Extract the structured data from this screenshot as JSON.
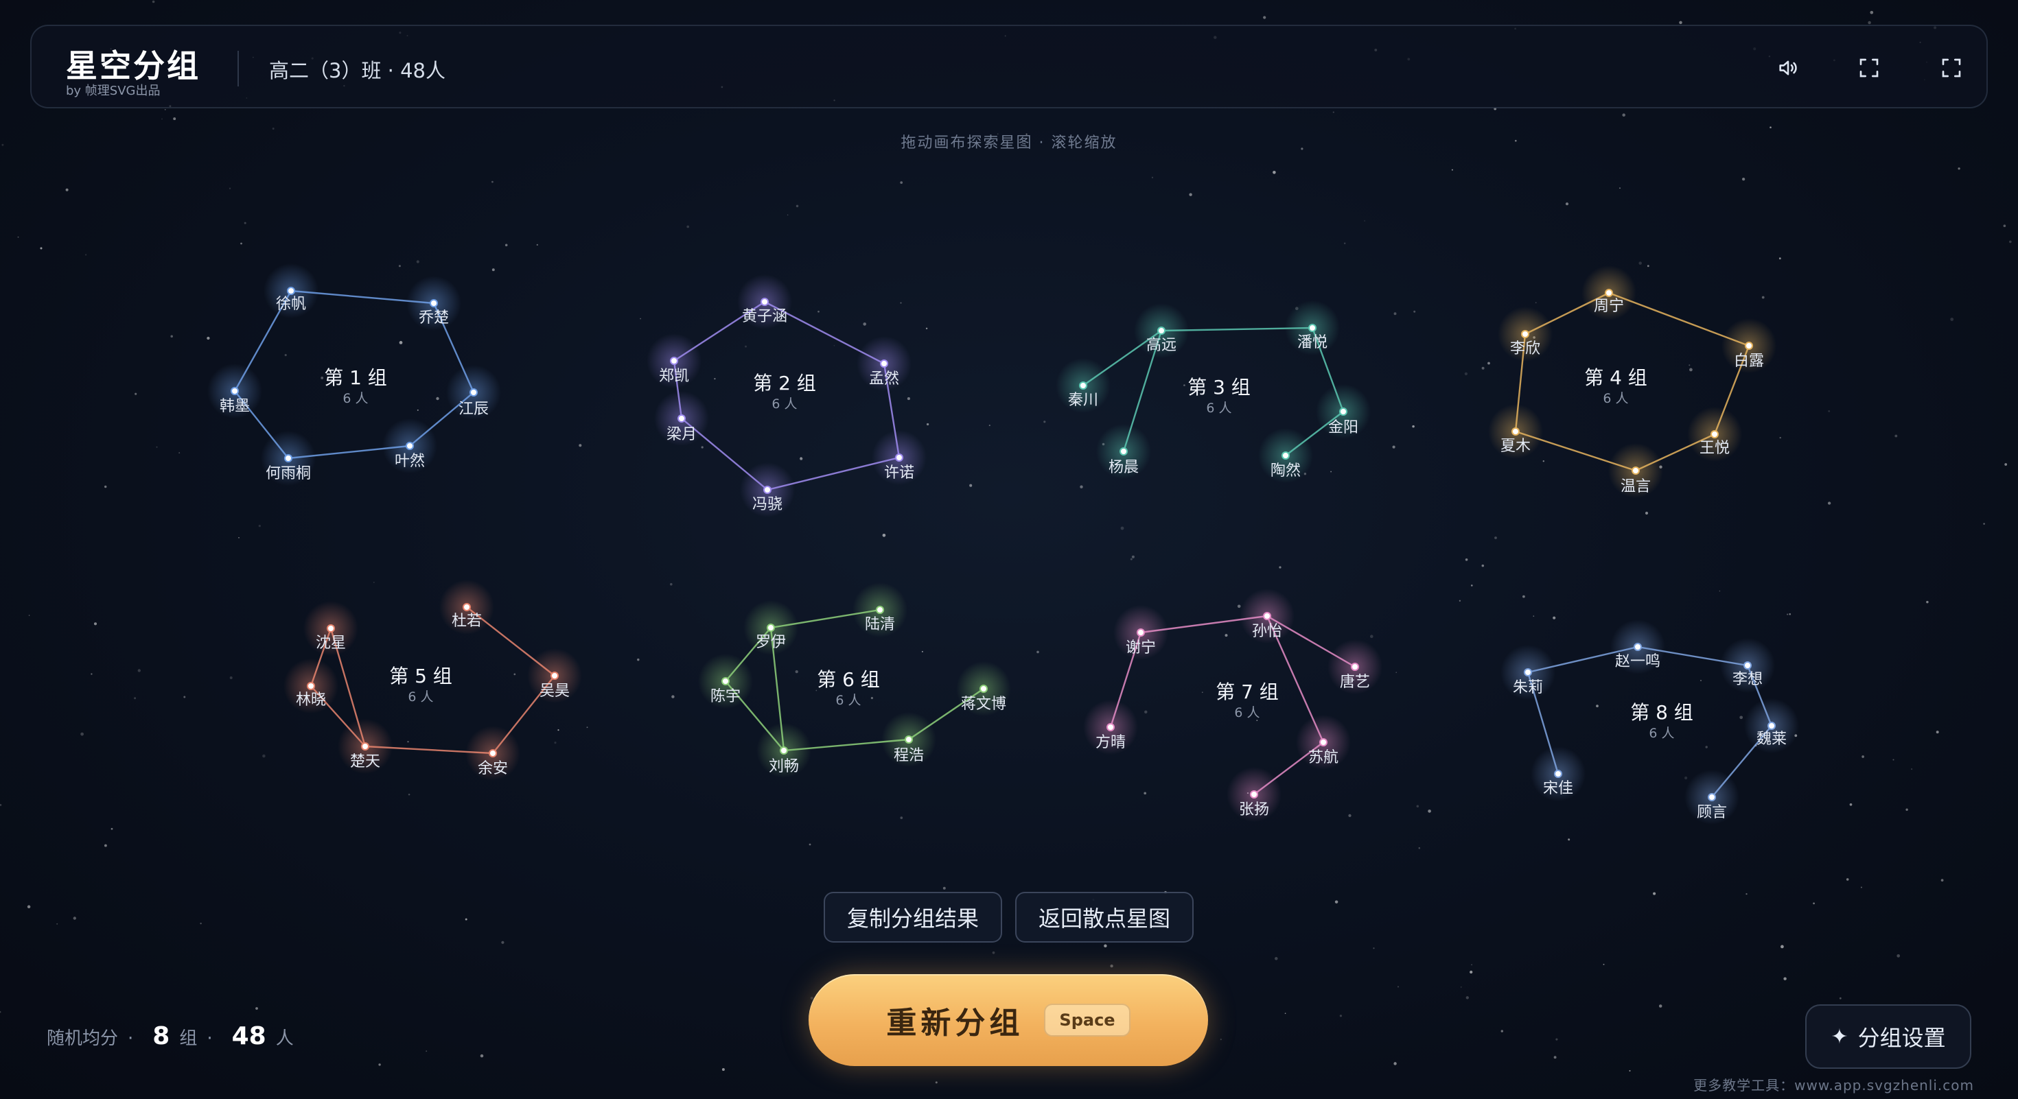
{
  "header": {
    "title": "星空分组",
    "subtitle": "by 帧理SVG出品",
    "class_info": "高二（3）班 · 48人",
    "icons": [
      "speaker-icon",
      "fullscreen-icon",
      "expand-icon"
    ]
  },
  "hint": "拖动画布探索星图 · 滚轮缩放",
  "groups": [
    {
      "name": "第 1 组",
      "count": "6 人",
      "color": "#6f9fe6",
      "members": [
        "徐帆",
        "乔楚",
        "江辰",
        "叶然",
        "何雨桐",
        "韩墨"
      ]
    },
    {
      "name": "第 2 组",
      "count": "6 人",
      "color": "#a08cf0",
      "members": [
        "黄子涵",
        "孟然",
        "许诺",
        "冯骁",
        "梁月",
        "郑凯"
      ]
    },
    {
      "name": "第 3 组",
      "count": "6 人",
      "color": "#5cc8b2",
      "members": [
        "秦川",
        "杨晨",
        "高远",
        "潘悦",
        "金阳",
        "陶然"
      ]
    },
    {
      "name": "第 4 组",
      "count": "6 人",
      "color": "#e6b45e",
      "members": [
        "周宁",
        "白露",
        "王悦",
        "温言",
        "夏木",
        "李欣"
      ]
    },
    {
      "name": "第 5 组",
      "count": "6 人",
      "color": "#e8856e",
      "members": [
        "沈星",
        "林晓",
        "楚天",
        "余安",
        "吴昊",
        "杜若"
      ]
    },
    {
      "name": "第 6 组",
      "count": "6 人",
      "color": "#8ed07a",
      "members": [
        "陆清",
        "罗伊",
        "陈宇",
        "刘畅",
        "程浩",
        "蒋文博"
      ]
    },
    {
      "name": "第 7 组",
      "count": "6 人",
      "color": "#e58cc6",
      "members": [
        "方晴",
        "谢宁",
        "孙怡",
        "唐艺",
        "苏航",
        "张扬"
      ]
    },
    {
      "name": "第 8 组",
      "count": "6 人",
      "color": "#7fa4e0",
      "members": [
        "宋佳",
        "朱莉",
        "赵一鸣",
        "李想",
        "魏莱",
        "顾言"
      ]
    }
  ],
  "actions": {
    "copy_label": "复制分组结果",
    "back_label": "返回散点星图",
    "regroup_label": "重新分组",
    "regroup_key": "Space",
    "settings_label": "分组设置"
  },
  "stats": {
    "prefix": "随机均分",
    "groups_num": "8",
    "groups_unit": "组",
    "people_num": "48",
    "people_unit": "人",
    "sep": "·"
  },
  "footer": "更多教学工具：www.app.svgzhenli.com"
}
